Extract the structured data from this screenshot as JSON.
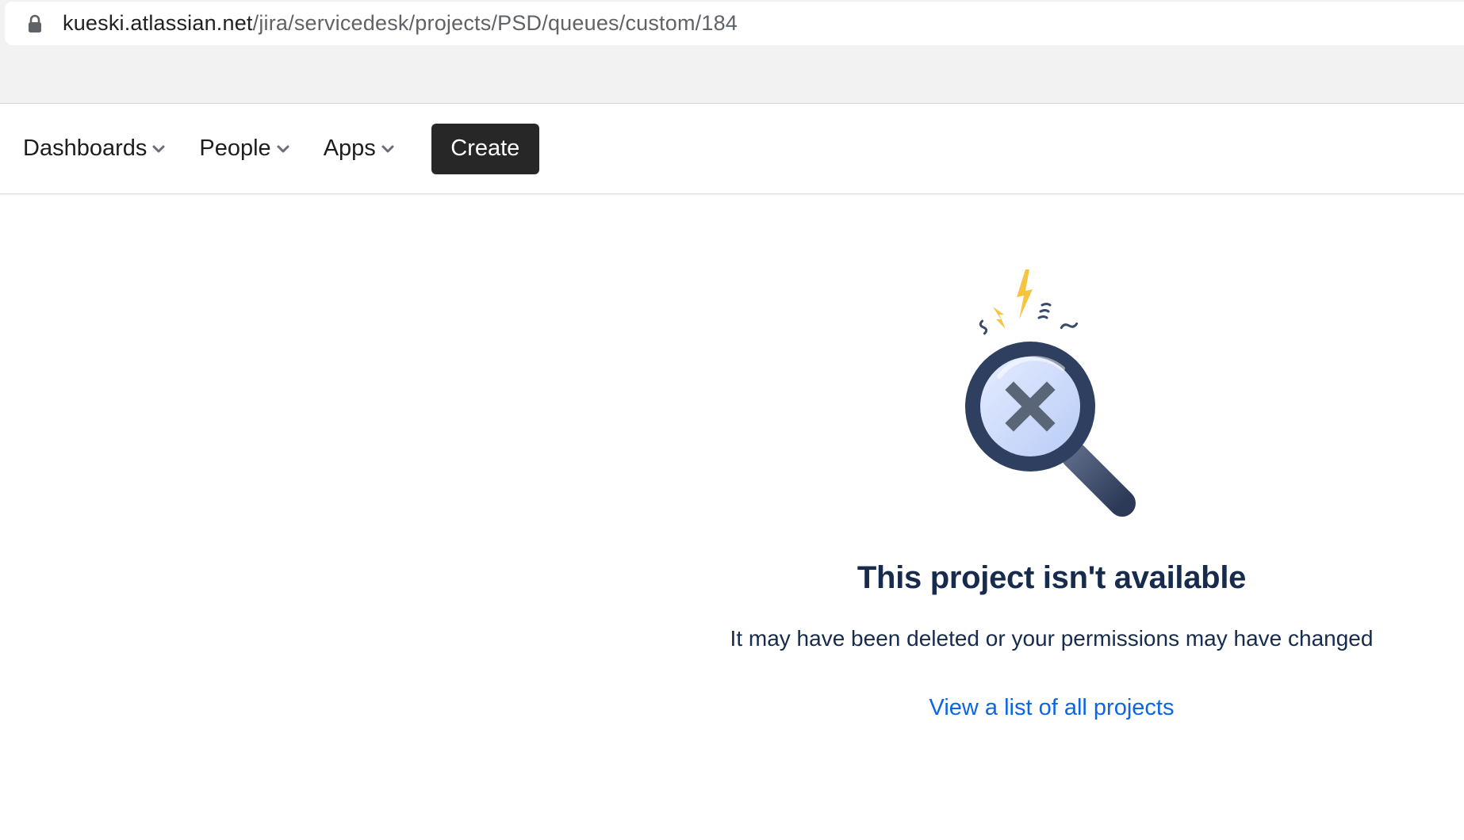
{
  "browser": {
    "url_domain": "kueski.atlassian.net",
    "url_path": "/jira/servicedesk/projects/PSD/queues/custom/184",
    "lock_icon": "lock-icon"
  },
  "nav": {
    "items": [
      {
        "label": "Dashboards",
        "icon": "chevron-down-icon"
      },
      {
        "label": "People",
        "icon": "chevron-down-icon"
      },
      {
        "label": "Apps",
        "icon": "chevron-down-icon"
      }
    ],
    "create_label": "Create"
  },
  "empty_state": {
    "illustration": "magnifier-x-icon",
    "title": "This project isn't available",
    "description": "It may have been deleted or your permissions may have changed",
    "link": "View a list of all projects"
  },
  "colors": {
    "link": "#0c66e4",
    "create_bg": "#272727",
    "text": "#172b4d",
    "lightning": "#f5c542"
  }
}
